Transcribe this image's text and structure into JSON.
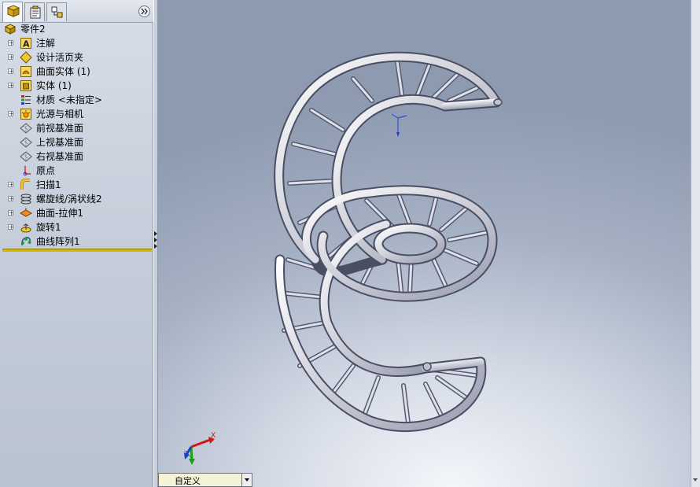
{
  "feature_manager": {
    "tabs": [
      {
        "name": "featuremanager-tab",
        "icon": "feature-tree-icon",
        "active": true
      },
      {
        "name": "propertymanager-tab",
        "icon": "property-icon",
        "active": false
      },
      {
        "name": "configurationmanager-tab",
        "icon": "configuration-icon",
        "active": false
      }
    ],
    "expand_icon": "double-chevron-right-icon",
    "root": {
      "label": "零件2",
      "icon": "part-icon"
    },
    "items": [
      {
        "label": "注解",
        "icon": "annotation-icon",
        "expandable": true
      },
      {
        "label": "设计活页夹",
        "icon": "design-binder-icon",
        "expandable": true
      },
      {
        "label": "曲面实体 (1)",
        "icon": "surface-body-icon",
        "expandable": true
      },
      {
        "label": "实体 (1)",
        "icon": "solid-body-icon",
        "expandable": true
      },
      {
        "label": "材质 <未指定>",
        "icon": "material-icon",
        "expandable": false
      },
      {
        "label": "光源与相机",
        "icon": "lights-camera-icon",
        "expandable": true
      },
      {
        "label": "前视基准面",
        "icon": "plane-icon",
        "expandable": false
      },
      {
        "label": "上视基准面",
        "icon": "plane-icon",
        "expandable": false
      },
      {
        "label": "右视基准面",
        "icon": "plane-icon",
        "expandable": false
      },
      {
        "label": "原点",
        "icon": "origin-icon",
        "expandable": false
      },
      {
        "label": "扫描1",
        "icon": "sweep-icon",
        "expandable": true
      },
      {
        "label": "螺旋线/涡状线2",
        "icon": "helix-icon",
        "expandable": true
      },
      {
        "label": "曲面-拉伸1",
        "icon": "surface-extrude-icon",
        "expandable": true
      },
      {
        "label": "旋转1",
        "icon": "revolve-icon",
        "expandable": true
      },
      {
        "label": "曲线阵列1",
        "icon": "curve-pattern-icon",
        "expandable": false
      }
    ]
  },
  "viewport": {
    "triad": {
      "x_label": "X",
      "y_label": "Y",
      "z_label": "Z"
    }
  },
  "configuration": {
    "selected": "自定义"
  },
  "colors": {
    "rollback_bar": "#d4b800",
    "triad_x": "#d01818",
    "triad_y": "#18a018",
    "triad_z": "#1840c0"
  }
}
